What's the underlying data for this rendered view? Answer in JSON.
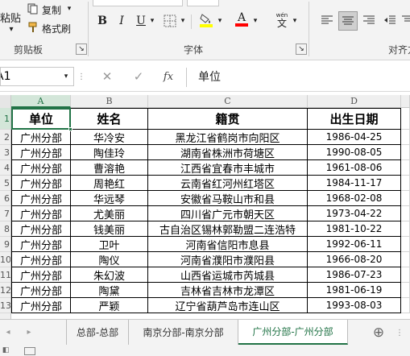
{
  "ribbon": {
    "paste_label": "粘贴",
    "copy_label": "复制",
    "format_painter_label": "格式刷",
    "clipboard_group": "剪贴板",
    "font_group": "字体",
    "align_group": "对齐方",
    "bold": "B",
    "italic": "I",
    "underline": "U",
    "font_color_letter": "A",
    "phonetic_top": "wén",
    "phonetic_bottom": "文",
    "accent_color": "#217346",
    "highlight_color": "#ffff00",
    "font_color": "#ff0000"
  },
  "formula_bar": {
    "name_box": "A1",
    "fx": "fx",
    "content": "单位"
  },
  "columns": [
    "A",
    "B",
    "C",
    "D"
  ],
  "rows": [
    "1",
    "2",
    "3",
    "4",
    "5",
    "6",
    "7",
    "8",
    "9",
    "10",
    "11",
    "12",
    "13"
  ],
  "table": {
    "headers": [
      "单位",
      "姓名",
      "籍贯",
      "出生日期"
    ],
    "rows": [
      [
        "广州分部",
        "华冷安",
        "黑龙江省鹤岗市向阳区",
        "1986-04-25"
      ],
      [
        "广州分部",
        "陶佳玲",
        "湖南省株洲市荷塘区",
        "1990-08-05"
      ],
      [
        "广州分部",
        "曹溶艳",
        "江西省宜春市丰城市",
        "1961-08-06"
      ],
      [
        "广州分部",
        "周艳红",
        "云南省红河州红塔区",
        "1984-11-17"
      ],
      [
        "广州分部",
        "华远琴",
        "安徽省马鞍山市和县",
        "1968-02-08"
      ],
      [
        "广州分部",
        "尤美丽",
        "四川省广元市朝天区",
        "1973-04-22"
      ],
      [
        "广州分部",
        "钱美丽",
        "古自治区锡林郭勒盟二连浩特",
        "1981-10-22"
      ],
      [
        "广州分部",
        "卫叶",
        "河南省信阳市息县",
        "1992-06-11"
      ],
      [
        "广州分部",
        "陶仪",
        "河南省濮阳市濮阳县",
        "1966-08-20"
      ],
      [
        "广州分部",
        "朱幻波",
        "山西省运城市芮城县",
        "1986-07-23"
      ],
      [
        "广州分部",
        "陶黛",
        "吉林省吉林市龙潭区",
        "1981-06-19"
      ],
      [
        "广州分部",
        "严颖",
        "辽宁省葫芦岛市连山区",
        "1993-08-03"
      ]
    ]
  },
  "sheets": [
    "总部-总部",
    "南京分部-南京分部",
    "广州分部-广州分部"
  ],
  "active_sheet": "广州分部-广州分部",
  "add_sheet": "⊕"
}
